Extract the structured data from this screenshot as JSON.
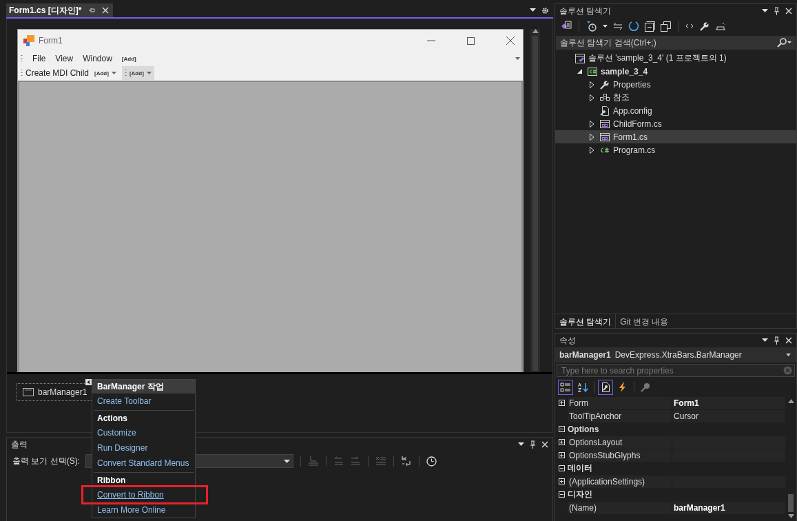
{
  "document_tab": {
    "title": "Form1.cs [디자인]*",
    "selected": true
  },
  "form": {
    "title": "Form1",
    "menu": [
      {
        "label": "File",
        "kind": "menu"
      },
      {
        "label": "View",
        "kind": "menu"
      },
      {
        "label": "Window",
        "kind": "menu"
      },
      {
        "label": "[Add]",
        "kind": "add"
      }
    ],
    "toolbar": [
      {
        "label": "Create MDI Child",
        "kind": "item"
      },
      {
        "label": "[Add]",
        "kind": "add-dropdown",
        "selected": false
      },
      {
        "label": "[Add]",
        "kind": "bar-add-dropdown",
        "selected": true
      }
    ]
  },
  "tray": {
    "component": "barManager1",
    "selected": true
  },
  "smart_tag": {
    "items": [
      {
        "kind": "header",
        "label": "BarManager 작업"
      },
      {
        "kind": "link",
        "label": "Create Toolbar",
        "highlighted": false
      },
      {
        "kind": "separator"
      },
      {
        "kind": "section",
        "label": "Actions"
      },
      {
        "kind": "link",
        "label": "Customize",
        "highlighted": false
      },
      {
        "kind": "link",
        "label": "Run Designer",
        "highlighted": false
      },
      {
        "kind": "link",
        "label": "Convert Standard Menus",
        "highlighted": false
      },
      {
        "kind": "separator"
      },
      {
        "kind": "section",
        "label": "Ribbon"
      },
      {
        "kind": "link",
        "label": "Convert to Ribbon",
        "highlighted": true
      },
      {
        "kind": "link",
        "label": "Learn More Online",
        "highlighted": false
      }
    ]
  },
  "output": {
    "title": "출력",
    "source_label": "출력 보기 선택(S):"
  },
  "solution_explorer": {
    "title": "솔루션 탐색기",
    "search": {
      "placeholder": "솔루션 탐색기 검색(Ctrl+;)"
    },
    "tree": [
      {
        "label": "솔루션 'sample_3_4'  (1 프로젝트의 1)",
        "kind": "solution",
        "selected": false,
        "children": [
          {
            "label": "sample_3_4",
            "kind": "csproj",
            "expandable": true,
            "expanded": true,
            "selected": false,
            "children": [
              {
                "label": "Properties",
                "kind": "wrench",
                "expandable": true,
                "expanded": false,
                "selected": false
              },
              {
                "label": "참조",
                "kind": "references",
                "expandable": true,
                "expanded": false,
                "selected": false
              },
              {
                "label": "App.config",
                "kind": "config",
                "expandable": false,
                "selected": false
              },
              {
                "label": "ChildForm.cs",
                "kind": "form",
                "expandable": true,
                "expanded": false,
                "selected": false
              },
              {
                "label": "Form1.cs",
                "kind": "form",
                "expandable": true,
                "expanded": false,
                "selected": true
              },
              {
                "label": "Program.cs",
                "kind": "csharp",
                "expandable": true,
                "expanded": false,
                "selected": false
              }
            ]
          }
        ]
      }
    ],
    "tabs": [
      {
        "label": "솔루션 탐색기",
        "selected": true
      },
      {
        "label": "Git 변경 내용",
        "selected": false
      }
    ]
  },
  "properties": {
    "title": "속성",
    "object_name": "barManager1",
    "object_type": "DevExpress.XtraBars.BarManager",
    "search": {
      "placeholder": "Type here to search properties"
    },
    "toolbar": [
      {
        "kind": "categorized",
        "selected": true
      },
      {
        "kind": "alphabetical",
        "selected": false
      },
      {
        "kind": "properties",
        "selected": true
      },
      {
        "kind": "events",
        "selected": false
      },
      {
        "kind": "property-pages",
        "selected": false
      }
    ],
    "rows": [
      {
        "kind": "property",
        "expandable": true,
        "expanded": false,
        "name": "Form",
        "value": "Form1",
        "modified": true
      },
      {
        "kind": "property",
        "expandable": false,
        "name": "ToolTipAnchor",
        "value": "Cursor",
        "modified": false
      },
      {
        "kind": "category",
        "expandable": true,
        "expanded": true,
        "name": "Options"
      },
      {
        "kind": "property",
        "expandable": true,
        "expanded": false,
        "name": "OptionsLayout"
      },
      {
        "kind": "property",
        "expandable": true,
        "expanded": false,
        "name": "OptionsStubGlyphs"
      },
      {
        "kind": "category",
        "expandable": true,
        "expanded": true,
        "name": "데이터"
      },
      {
        "kind": "property",
        "expandable": true,
        "expanded": false,
        "name": "(ApplicationSettings)"
      },
      {
        "kind": "category",
        "expandable": true,
        "expanded": true,
        "name": "디자인"
      },
      {
        "kind": "property",
        "expandable": false,
        "name": "(Name)",
        "value": "barManager1",
        "modified": true
      }
    ]
  }
}
